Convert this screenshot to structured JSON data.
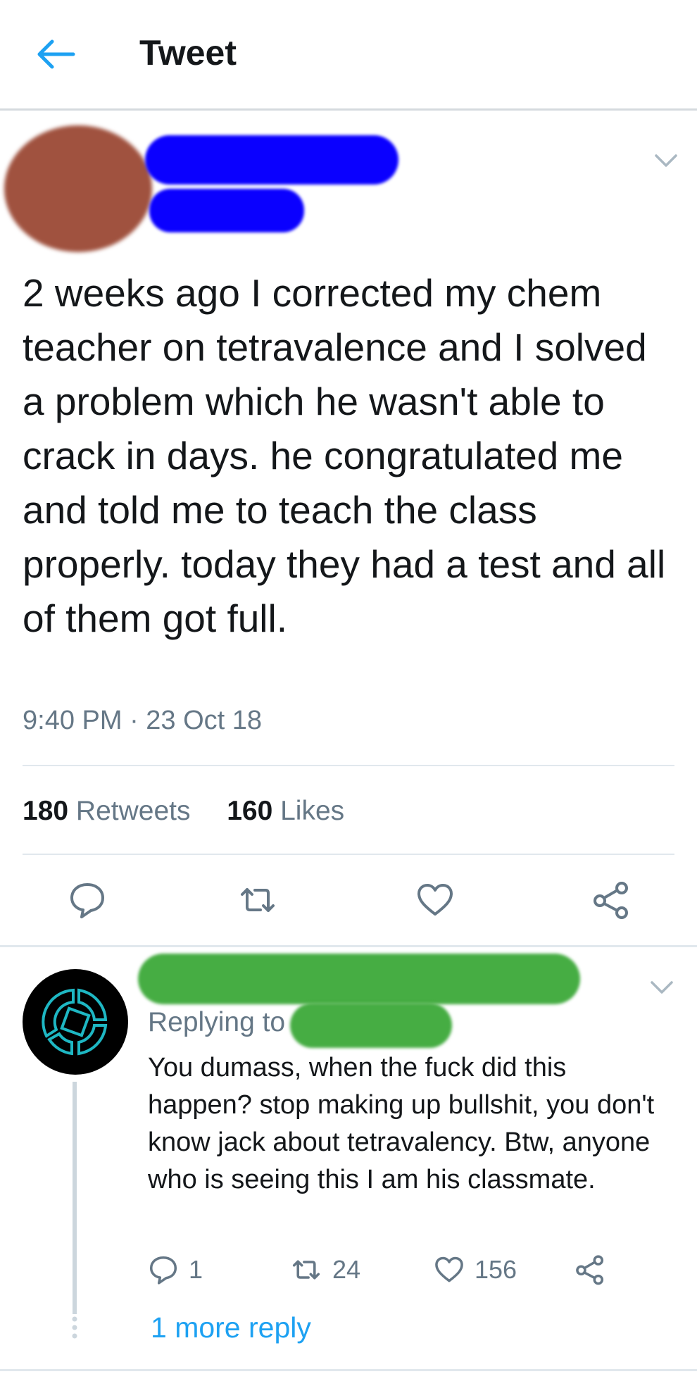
{
  "header": {
    "title": "Tweet",
    "back_icon": "back-arrow-icon",
    "accent": "#1da1f2"
  },
  "tweet": {
    "text": "2 weeks ago I corrected my chem teacher on tetravalence and I solved a problem which he wasn't able to crack in days. he congratulated me and told me to teach the class properly. today they had a test and all of them got full.",
    "timestamp": "9:40 PM · 23 Oct 18",
    "retweets_count": "180",
    "retweets_label": "Retweets",
    "likes_count": "160",
    "likes_label": "Likes",
    "actions": [
      "reply-icon",
      "retweet-icon",
      "like-icon",
      "share-icon"
    ],
    "redaction_color": "#0a00ff"
  },
  "reply": {
    "replying_to": "Replying to",
    "text": "You dumass, when the fuck did this happen? stop making up bullshit, you don't know jack about tetravalency. Btw, anyone who is seeing this I am his classmate.",
    "reply_count": "1",
    "retweet_count": "24",
    "like_count": "156",
    "more_replies": "1 more reply",
    "redaction_color": "#46ad43"
  }
}
